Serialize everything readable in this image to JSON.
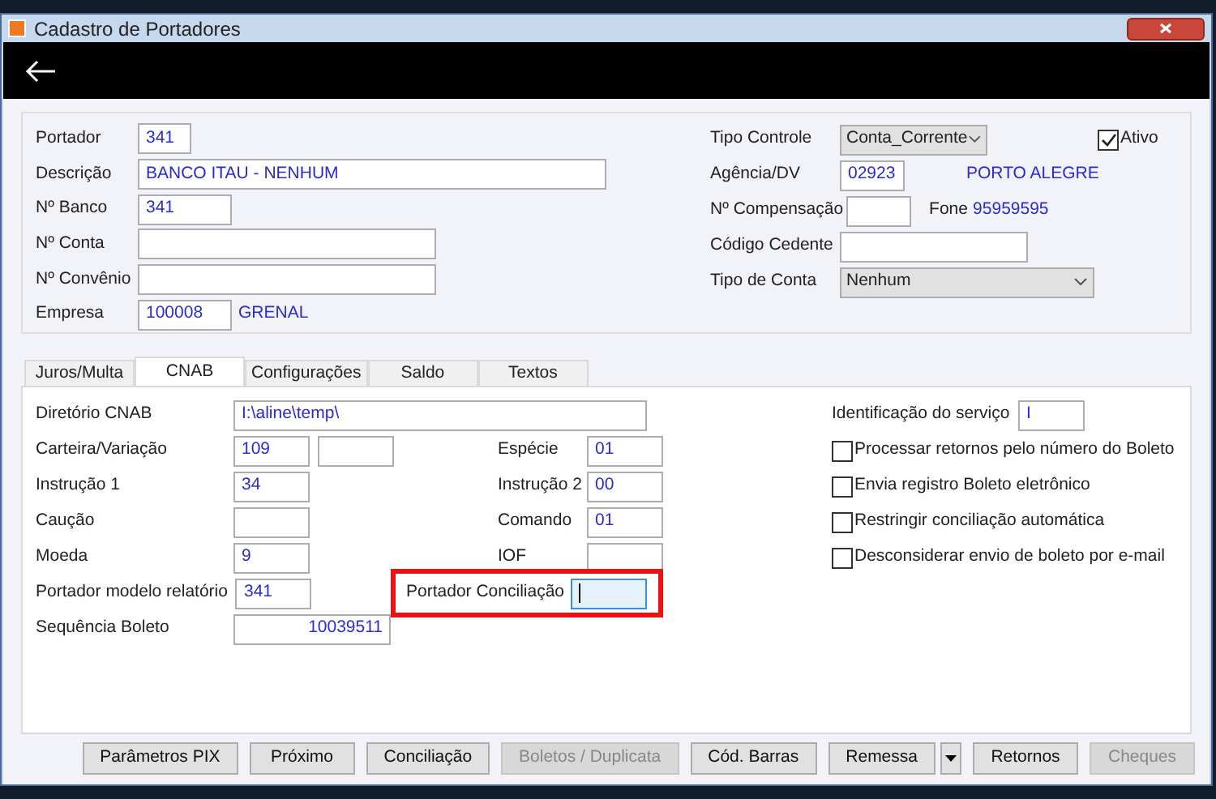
{
  "window": {
    "title": "Cadastro de Portadores"
  },
  "main": {
    "portador": {
      "label": "Portador",
      "value": "341"
    },
    "descricao": {
      "label": "Descrição",
      "value": "BANCO ITAU - NENHUM"
    },
    "banco": {
      "label": "Nº Banco",
      "value": "341"
    },
    "conta": {
      "label": "Nº Conta"
    },
    "convenio": {
      "label": "Nº Convênio"
    },
    "empresa": {
      "label": "Empresa",
      "value": "100008",
      "name": "GRENAL"
    },
    "tipo_controle": {
      "label": "Tipo Controle",
      "value": "Conta_Corrente"
    },
    "ativo": {
      "label": "Ativo",
      "checked": true
    },
    "agencia": {
      "label": "Agência/DV",
      "value": "02923",
      "city": "PORTO ALEGRE"
    },
    "compensacao": {
      "label": "Nº Compensação"
    },
    "fone": {
      "label": "Fone",
      "value": "95959595"
    },
    "cedente": {
      "label": "Código Cedente"
    },
    "tipo_conta": {
      "label": "Tipo de Conta",
      "value": "Nenhum"
    }
  },
  "tabs": [
    {
      "label": "Juros/Multa",
      "selected": false
    },
    {
      "label": "CNAB",
      "selected": true
    },
    {
      "label": "Configurações",
      "selected": false
    },
    {
      "label": "Saldo",
      "selected": false
    },
    {
      "label": "Textos",
      "selected": false
    }
  ],
  "cnab": {
    "diretorio": {
      "label": "Diretório CNAB",
      "value": "I:\\aline\\temp\\"
    },
    "rows": [
      {
        "label": "Carteira/Variação",
        "value": "109",
        "extra_field": true,
        "mid": {
          "label": "Espécie",
          "value": "01"
        }
      },
      {
        "label": "Instrução 1",
        "value": "34",
        "mid": {
          "label": "Instrução 2",
          "value": "00"
        }
      },
      {
        "label": "Caução",
        "mid": {
          "label": "Comando",
          "value": "01"
        }
      },
      {
        "label": "Moeda",
        "value": "9",
        "mid": {
          "label": "IOF"
        }
      },
      {
        "label": "Portador modelo relatório",
        "value": "341",
        "mid": {
          "label": "Portador Conciliação",
          "focused": true,
          "highlighted": true
        }
      }
    ],
    "sequencia": {
      "label": "Sequência Boleto",
      "value": "10039511"
    },
    "identificacao": {
      "label": "Identificação do serviço",
      "value": "I"
    },
    "options": [
      {
        "label": "Processar retornos pelo número do Boleto",
        "checked": false
      },
      {
        "label": "Envia registro Boleto eletrônico",
        "checked": false
      },
      {
        "label": "Restringir conciliação automática",
        "checked": false
      },
      {
        "label": "Desconsiderar envio de boleto por e-mail",
        "checked": false
      }
    ]
  },
  "buttons": [
    {
      "kind": "button",
      "label": "Parâmetros PIX",
      "disabled": false
    },
    {
      "kind": "button",
      "label": "Próximo",
      "disabled": false
    },
    {
      "kind": "button",
      "label": "Conciliação",
      "disabled": false
    },
    {
      "kind": "button",
      "label": "Boletos / Duplicata",
      "disabled": true
    },
    {
      "kind": "button",
      "label": "Cód. Barras",
      "disabled": false
    },
    {
      "kind": "button",
      "label": "Remessa",
      "disabled": false
    },
    {
      "kind": "dropdown",
      "disabled": false
    },
    {
      "kind": "button",
      "label": "Retornos",
      "disabled": false
    },
    {
      "kind": "button",
      "label": "Cheques",
      "disabled": true
    }
  ]
}
